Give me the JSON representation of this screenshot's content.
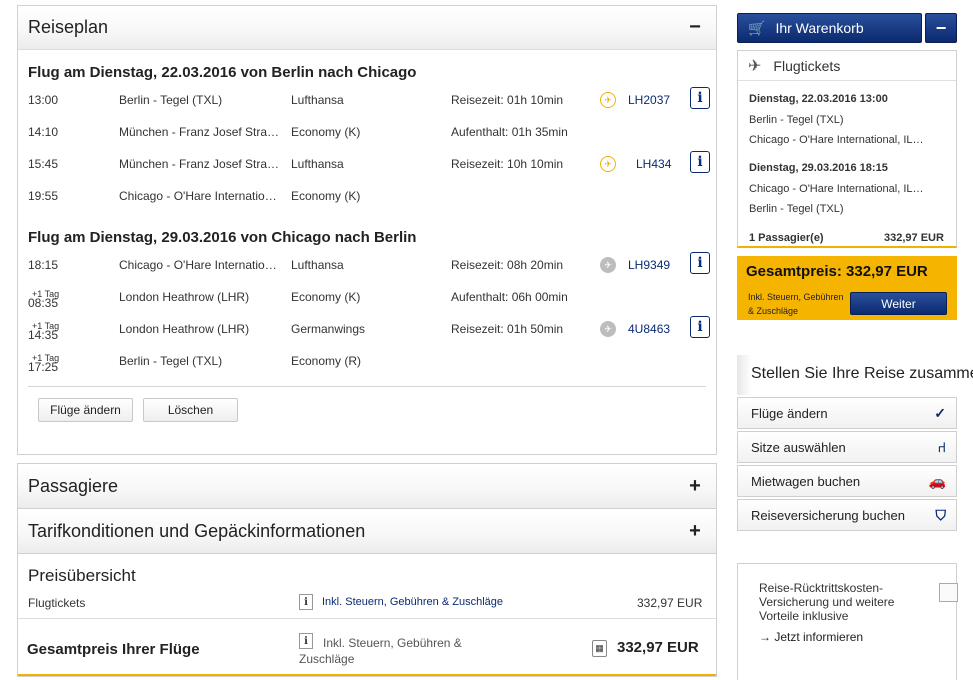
{
  "reiseplan": {
    "title": "Reiseplan",
    "toggle": "−",
    "legs": [
      {
        "title": "Flug am Dienstag, 22.03.2016 von Berlin nach Chicago",
        "segments": [
          {
            "time": "13:00",
            "plus": "",
            "airport": "Berlin - Tegel (TXL)",
            "airline": "Lufthansa",
            "info": "Reisezeit: 01h 10min",
            "logo": "lufthansa-crane-icon",
            "flight": "LH2037",
            "info_icon": "i"
          },
          {
            "time": "14:10",
            "plus": "",
            "airport": "München - Franz Josef Stra…",
            "airline": "Economy (K)",
            "info": "Aufenthalt: 01h 35min",
            "logo": "",
            "flight": "",
            "info_icon": ""
          },
          {
            "time": "15:45",
            "plus": "",
            "airport": "München - Franz Josef Stra…",
            "airline": "Lufthansa",
            "info": "Reisezeit: 10h 10min",
            "logo": "lufthansa-crane-icon",
            "flight": "LH434",
            "info_icon": "i"
          },
          {
            "time": "19:55",
            "plus": "",
            "airport": "Chicago - O'Hare Internatio…",
            "airline": "Economy (K)",
            "info": "",
            "logo": "",
            "flight": "",
            "info_icon": ""
          }
        ]
      },
      {
        "title": "Flug am Dienstag, 29.03.2016 von Chicago nach Berlin",
        "segments": [
          {
            "time": "18:15",
            "plus": "",
            "airport": "Chicago - O'Hare Internatio…",
            "airline": "Lufthansa",
            "info": "Reisezeit: 08h 20min",
            "logo": "airline-gray-icon",
            "flight": "LH9349",
            "info_icon": "i"
          },
          {
            "time": "08:35",
            "plus": "+1 Tag",
            "airport": "London Heathrow (LHR)",
            "airline": "Economy (K)",
            "info": "Aufenthalt: 06h 00min",
            "logo": "",
            "flight": "",
            "info_icon": ""
          },
          {
            "time": "14:35",
            "plus": "+1 Tag",
            "airport": "London Heathrow (LHR)",
            "airline": "Germanwings",
            "info": "Reisezeit: 01h 50min",
            "logo": "airline-gray-icon",
            "flight": "4U8463",
            "info_icon": "i"
          },
          {
            "time": "17:25",
            "plus": "+1 Tag",
            "airport": "Berlin - Tegel (TXL)",
            "airline": "Economy (R)",
            "info": "",
            "logo": "",
            "flight": "",
            "info_icon": ""
          }
        ]
      }
    ],
    "buttons": {
      "change": "Flüge ändern",
      "delete": "Löschen"
    }
  },
  "passagiere": {
    "title": "Passagiere",
    "toggle": "+"
  },
  "tarif": {
    "title": "Tarifkonditionen und Gepäckinformationen",
    "toggle": "+"
  },
  "preis": {
    "title": "Preisübersicht",
    "row_label": "Flugtickets",
    "row_icon": "i",
    "row_note": "Inkl. Steuern, Gebühren & Zuschläge",
    "row_amount": "332,97 EUR",
    "total_label": "Gesamtpreis Ihrer Flüge",
    "total_icon": "i",
    "total_note_1": "Inkl. Steuern, Gebühren &",
    "total_note_2": "Zuschläge",
    "total_amount": "332,97 EUR"
  },
  "cart": {
    "label": "Ihr Warenkorb",
    "minimize": "−",
    "tickets_label": "Flugtickets",
    "out_date": "Dienstag, 22.03.2016 13:00",
    "out_from": "Berlin - Tegel (TXL)",
    "out_to": "Chicago - O'Hare International, IL…",
    "ret_date": "Dienstag, 29.03.2016 18:15",
    "ret_from": "Chicago - O'Hare International, IL…",
    "ret_to": "Berlin - Tegel (TXL)",
    "passengers": "1 Passagier(e)",
    "passengers_amount": "332,97 EUR",
    "total_label": "Gesamtpreis:",
    "total_amount": "332,97 EUR",
    "total_note_1": "Inkl. Steuern, Gebühren",
    "total_note_2": "& Zuschläge",
    "continue": "Weiter"
  },
  "stellen": {
    "title": "Stellen Sie Ihre Reise zusammen",
    "options": [
      {
        "label": "Flüge ändern",
        "icon": "checkmark-icon"
      },
      {
        "label": "Sitze auswählen",
        "icon": "seat-icon"
      },
      {
        "label": "Mietwagen buchen",
        "icon": "car-icon"
      },
      {
        "label": "Reiseversicherung buchen",
        "icon": "shield-icon"
      }
    ]
  },
  "insurance": {
    "text": "Reise-Rücktrittskosten-Versicherung und weitere Vorteile inklusive",
    "link": "Jetzt informieren"
  },
  "colors": {
    "accent": "#f4b400",
    "brand_blue": "#0b2a6f"
  }
}
